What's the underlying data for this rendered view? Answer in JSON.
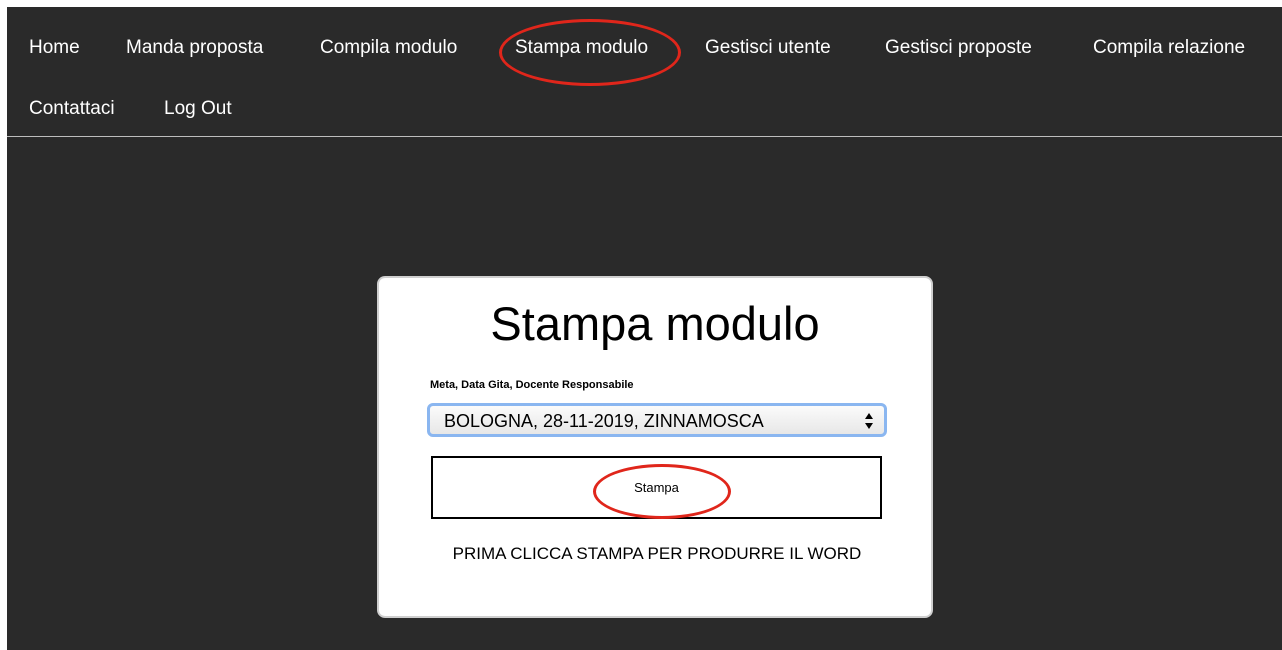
{
  "nav": {
    "items": [
      {
        "label": "Home"
      },
      {
        "label": "Manda proposta"
      },
      {
        "label": "Compila modulo"
      },
      {
        "label": "Stampa modulo"
      },
      {
        "label": "Gestisci utente"
      },
      {
        "label": "Gestisci proposte"
      },
      {
        "label": "Compila relazione"
      },
      {
        "label": "Contattaci"
      },
      {
        "label": "Log Out"
      }
    ]
  },
  "form": {
    "title": "Stampa modulo",
    "field_label": "Meta, Data Gita, Docente Responsabile",
    "selected_option": "BOLOGNA, 28-11-2019, ZINNAMOSCA",
    "button_label": "Stampa",
    "note": "PRIMA CLICCA STAMPA PER PRODURRE IL WORD"
  },
  "colors": {
    "background": "#2a2a2a",
    "nav_text": "#ffffff",
    "highlight_ring": "#e0261b",
    "select_focus": "#8ab6f0"
  }
}
